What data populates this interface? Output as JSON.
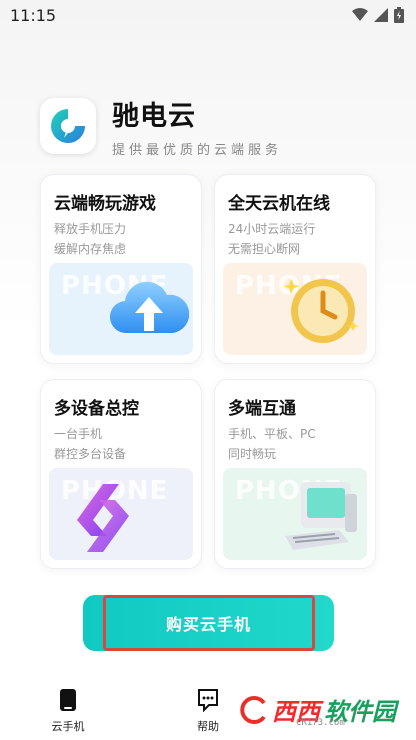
{
  "status_bar": {
    "time": "11:15",
    "icons": [
      "wifi-icon",
      "signal-icon",
      "battery-icon"
    ]
  },
  "brand": {
    "name": "驰电云",
    "slogan": "提供最优质的云端服务"
  },
  "cards": [
    {
      "title": "云端畅玩游戏",
      "desc": [
        "释放手机压力",
        "缓解内存焦虑"
      ],
      "watermark": "PHONE",
      "icon": "cloud-upload-icon",
      "bg": "#e6f2fc"
    },
    {
      "title": "全天云机在线",
      "desc": [
        "24小时云端运行",
        "无需担心断网"
      ],
      "watermark": "PHONE",
      "icon": "clock-icon",
      "bg": "#fdf0e4"
    },
    {
      "title": "多设备总控",
      "desc": [
        "一台手机",
        "群控多台设备"
      ],
      "watermark": "PHONE",
      "icon": "sync-icon",
      "bg": "#eef0fa"
    },
    {
      "title": "多端互通",
      "desc": [
        "手机、平板、PC",
        "同时畅玩"
      ],
      "watermark": "PHONE",
      "icon": "computer-icon",
      "bg": "#e7f6ee"
    }
  ],
  "buy_button": {
    "label": "购买云手机"
  },
  "bottom_nav": {
    "items": [
      {
        "label": "云手机",
        "icon": "phone-icon"
      },
      {
        "label": "帮助",
        "icon": "help-chat-icon"
      }
    ]
  },
  "watermark": {
    "text1": "西西",
    "text2": "软件园",
    "sub": "CR173.com"
  },
  "colors": {
    "accent": "#10c9c2",
    "highlight_border": "#d9483c"
  }
}
